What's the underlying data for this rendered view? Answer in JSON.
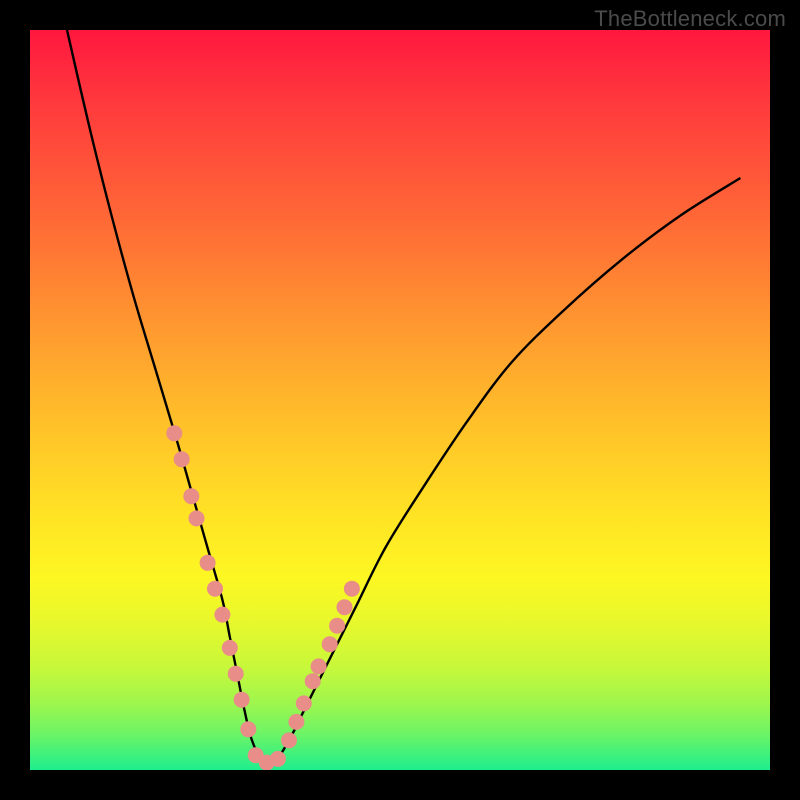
{
  "watermark": "TheBottleneck.com",
  "chart_data": {
    "type": "line",
    "title": "",
    "xlabel": "",
    "ylabel": "",
    "xlim": [
      0,
      100
    ],
    "ylim": [
      0,
      100
    ],
    "grid": false,
    "legend": false,
    "gradient_colors_top_to_bottom": [
      "#ff173e",
      "#ff6a36",
      "#ffc329",
      "#fdf723",
      "#9ef64d",
      "#1eee8f"
    ],
    "series": [
      {
        "name": "curve",
        "x": [
          5,
          8,
          11,
          14,
          17,
          20,
          22,
          24,
          26,
          27,
          28,
          29,
          30,
          31.5,
          33,
          35,
          37,
          40,
          44,
          48,
          53,
          59,
          65,
          72,
          80,
          88,
          96
        ],
        "y": [
          100,
          87,
          75,
          64,
          54,
          44,
          37,
          30,
          23,
          18,
          13,
          8,
          4,
          1,
          1,
          4,
          8,
          14,
          22,
          30,
          38,
          47,
          55,
          62,
          69,
          75,
          80
        ],
        "color": "#000000",
        "linewidth": 2
      }
    ],
    "markers": {
      "name": "points",
      "color": "#e98d88",
      "radius": 8,
      "x": [
        19.5,
        20.5,
        21.8,
        22.5,
        24.0,
        25.0,
        26.0,
        27.0,
        27.8,
        28.6,
        29.5,
        30.5,
        32.0,
        33.5,
        35.0,
        36.0,
        37.0,
        38.2,
        39.0,
        40.5,
        41.5,
        42.5,
        43.5
      ],
      "y": [
        45.5,
        42.0,
        37.0,
        34.0,
        28.0,
        24.5,
        21.0,
        16.5,
        13.0,
        9.5,
        5.5,
        2.0,
        1.0,
        1.5,
        4.0,
        6.5,
        9.0,
        12.0,
        14.0,
        17.0,
        19.5,
        22.0,
        24.5
      ]
    }
  }
}
